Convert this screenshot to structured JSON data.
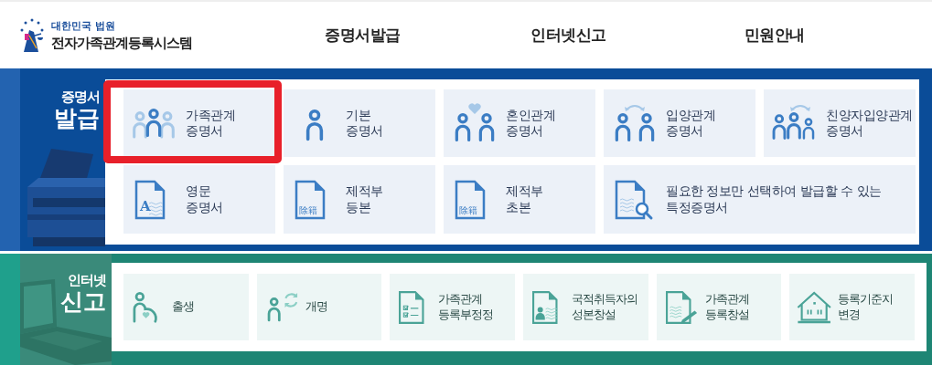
{
  "header": {
    "org": "대한민국 법원",
    "title": "전자가족관계등록시스템",
    "nav": [
      {
        "label": "증명서발급"
      },
      {
        "label": "인터넷신고"
      },
      {
        "label": "민원안내"
      }
    ]
  },
  "sections": [
    {
      "kind": "issue",
      "title_small": "증명서",
      "title_big": "발급",
      "tiles": [
        {
          "label": "가족관계\n증명서",
          "selected": true
        },
        {
          "label": "기본\n증명서",
          "selected": false
        },
        {
          "label": "혼인관계\n증명서",
          "selected": false
        },
        {
          "label": "입양관계\n증명서",
          "selected": false
        },
        {
          "label": "친양자입양관계\n증명서",
          "selected": false
        },
        {
          "label": "영문\n증명서",
          "icon_text": "A",
          "selected": false
        },
        {
          "label": "제적부\n등본",
          "icon_text": "除籍",
          "selected": false
        },
        {
          "label": "제적부\n초본",
          "icon_text": "除籍",
          "selected": false
        },
        {
          "label": "필요한 정보만 선택하여 발급할 수 있는\n특정증명서",
          "selected": false
        }
      ]
    },
    {
      "kind": "report",
      "title_small": "인터넷",
      "title_big": "신고",
      "tiles": [
        {
          "label": "출생",
          "selected": false
        },
        {
          "label": "개명",
          "selected": false
        },
        {
          "label": "가족관계\n등록부정정",
          "selected": false
        },
        {
          "label": "국적취득자의\n성본창설",
          "selected": false
        },
        {
          "label": "가족관계\n등록창설",
          "selected": false
        },
        {
          "label": "등록기준지\n변경",
          "selected": false
        }
      ]
    }
  ]
}
